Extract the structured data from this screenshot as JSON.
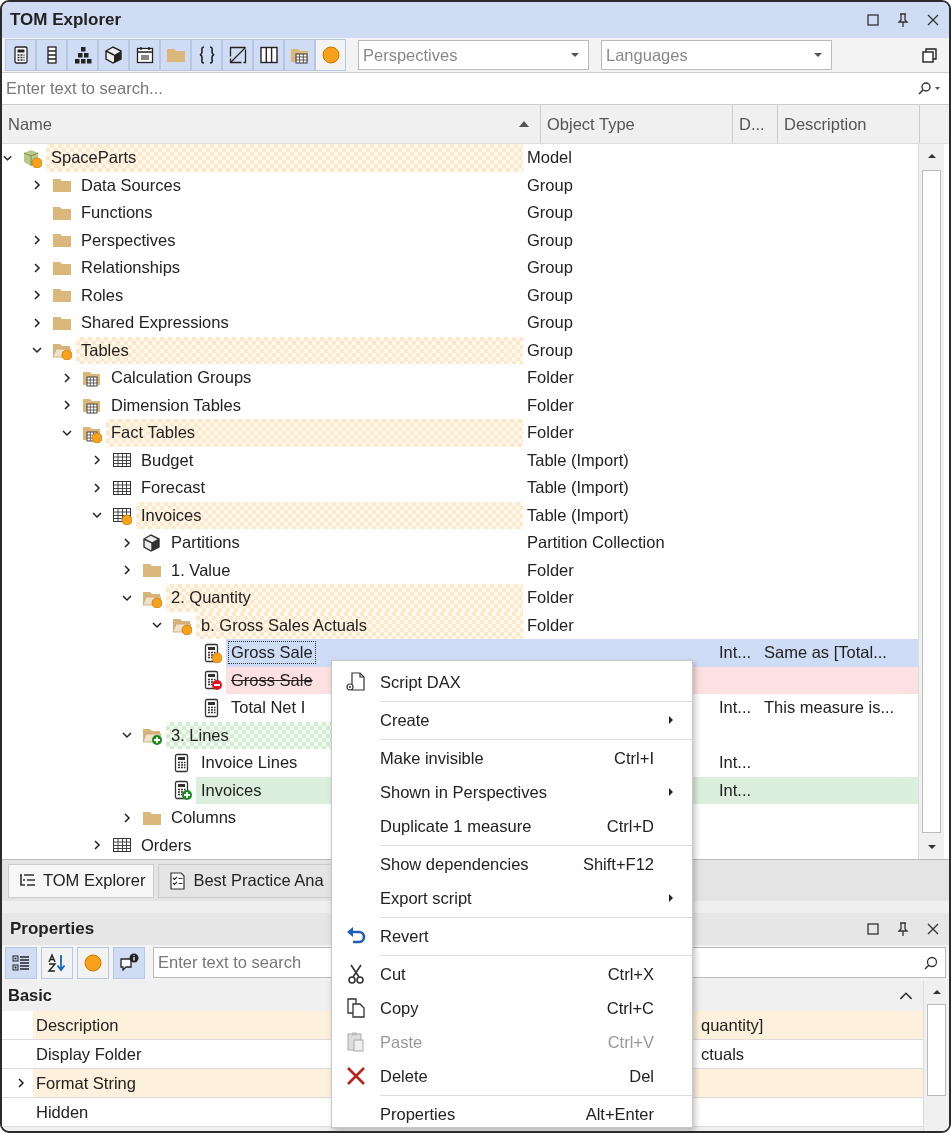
{
  "window": {
    "title": "TOM Explorer"
  },
  "toolbar": {
    "buttons": [
      {
        "kind": "calculator",
        "selected": true
      },
      {
        "kind": "column",
        "selected": true
      },
      {
        "kind": "hierarchy",
        "selected": true
      },
      {
        "kind": "cube",
        "selected": true
      },
      {
        "kind": "calendar",
        "selected": true
      },
      {
        "kind": "folder",
        "selected": true
      },
      {
        "kind": "braces",
        "selected": true
      },
      {
        "kind": "diagonal",
        "selected": true
      },
      {
        "kind": "columns",
        "selected": true
      },
      {
        "kind": "table-folder",
        "selected": true
      },
      {
        "kind": "dot",
        "selected": false
      }
    ],
    "perspectives": "Perspectives",
    "languages": "Languages"
  },
  "search": {
    "placeholder": "Enter text to search..."
  },
  "columns": [
    {
      "label": "Name",
      "sort_ascending": true
    },
    {
      "label": "Object Type"
    },
    {
      "label": "D..."
    },
    {
      "label": "Description"
    }
  ],
  "tree": [
    {
      "name": "SpaceParts",
      "type": "Model",
      "kind": "model",
      "modified": true,
      "expanded": true,
      "children": [
        {
          "name": "Data Sources",
          "type": "Group",
          "kind": "folder",
          "modified": false,
          "expanded": false
        },
        {
          "name": "Functions",
          "type": "Group",
          "kind": "folder",
          "modified": false
        },
        {
          "name": "Perspectives",
          "type": "Group",
          "kind": "folder",
          "modified": false,
          "expanded": false
        },
        {
          "name": "Relationships",
          "type": "Group",
          "kind": "folder",
          "modified": false,
          "expanded": false
        },
        {
          "name": "Roles",
          "type": "Group",
          "kind": "folder",
          "modified": false,
          "expanded": false
        },
        {
          "name": "Shared Expressions",
          "type": "Group",
          "kind": "folder",
          "modified": false,
          "expanded": false
        },
        {
          "name": "Tables",
          "type": "Group",
          "kind": "folder-open",
          "modified": true,
          "expanded": true,
          "children": [
            {
              "name": "Calculation Groups",
              "type": "Folder",
              "kind": "table-folder",
              "modified": false,
              "expanded": false
            },
            {
              "name": "Dimension Tables",
              "type": "Folder",
              "kind": "table-folder",
              "modified": false,
              "expanded": false
            },
            {
              "name": "Fact Tables",
              "type": "Folder",
              "kind": "table-folder",
              "modified": true,
              "expanded": true,
              "children": [
                {
                  "name": "Budget",
                  "type": "Table (Import)",
                  "kind": "table",
                  "modified": false,
                  "expanded": false
                },
                {
                  "name": "Forecast",
                  "type": "Table (Import)",
                  "kind": "table",
                  "modified": false,
                  "expanded": false
                },
                {
                  "name": "Invoices",
                  "type": "Table (Import)",
                  "kind": "table",
                  "modified": true,
                  "expanded": true,
                  "children": [
                    {
                      "name": "Partitions",
                      "type": "Partition Collection",
                      "kind": "partitions",
                      "modified": false,
                      "expanded": false
                    },
                    {
                      "name": "1. Value",
                      "type": "Folder",
                      "kind": "folder",
                      "modified": false,
                      "expanded": false
                    },
                    {
                      "name": "2. Quantity",
                      "type": "Folder",
                      "kind": "folder-open",
                      "modified": true,
                      "expanded": true,
                      "children": [
                        {
                          "name": "b. Gross Sales Actuals",
                          "type": "Folder",
                          "kind": "folder-open",
                          "modified": true,
                          "expanded": true,
                          "children": [
                            {
                              "name": "Gross Sale",
                              "kind": "measure",
                              "modified": true,
                              "added": false,
                              "deleted": false,
                              "selected": true,
                              "d": "Int...",
                              "description": "Same as [Total..."
                            },
                            {
                              "name": "Gross Sale",
                              "kind": "measure",
                              "modified": false,
                              "added": false,
                              "deleted": true,
                              "selected": false
                            },
                            {
                              "name": "Total Net I",
                              "kind": "measure",
                              "modified": false,
                              "added": false,
                              "deleted": false,
                              "selected": false,
                              "d": "Int...",
                              "description": "This measure is..."
                            }
                          ]
                        }
                      ]
                    },
                    {
                      "name": "3. Lines",
                      "kind": "folder-open",
                      "modified": false,
                      "added": true,
                      "expanded": true,
                      "children": [
                        {
                          "name": "Invoice Lines",
                          "kind": "measure",
                          "modified": false,
                          "added": false,
                          "deleted": false,
                          "selected": false,
                          "d": "Int..."
                        },
                        {
                          "name": "Invoices",
                          "kind": "measure",
                          "modified": false,
                          "added": true,
                          "deleted": false,
                          "selected": false,
                          "d": "Int..."
                        }
                      ]
                    },
                    {
                      "name": "Columns",
                      "kind": "folder",
                      "modified": false,
                      "expanded": false
                    }
                  ]
                },
                {
                  "name": "Orders",
                  "kind": "table",
                  "modified": false,
                  "expanded": false
                }
              ]
            }
          ]
        }
      ]
    }
  ],
  "bottom_tabs": [
    {
      "label": "TOM Explorer",
      "kind": "tree",
      "selected": true
    },
    {
      "label": "Best Practice Ana",
      "kind": "checklist",
      "selected": false
    }
  ],
  "properties": {
    "title": "Properties",
    "toolbar": [
      {
        "kind": "categorized",
        "selected": true
      },
      {
        "kind": "sort-az",
        "selected": false
      },
      {
        "kind": "dot",
        "selected": false
      },
      {
        "kind": "comment",
        "selected": true
      }
    ],
    "search": {
      "placeholder": "Enter text to search"
    },
    "category": "Basic",
    "rows": [
      {
        "name": "Description",
        "value": "quantity]",
        "modified": true
      },
      {
        "name": "Display Folder",
        "value": "ctuals",
        "modified": false
      },
      {
        "name": "Format String",
        "modified": true,
        "expanded": false
      },
      {
        "name": "Hidden",
        "modified": false
      }
    ]
  },
  "context_menu": [
    {
      "kind": "script",
      "label": "Script DAX"
    },
    {
      "kind": "separator"
    },
    {
      "kind": "item",
      "label": "Create",
      "submenu": true
    },
    {
      "kind": "separator"
    },
    {
      "kind": "item",
      "label": "Make invisible",
      "shortcut": "Ctrl+I"
    },
    {
      "kind": "item",
      "label": "Shown in Perspectives",
      "submenu": true
    },
    {
      "kind": "item",
      "label": "Duplicate 1 measure",
      "shortcut": "Ctrl+D"
    },
    {
      "kind": "separator"
    },
    {
      "kind": "item",
      "label": "Show dependencies",
      "shortcut": "Shift+F12"
    },
    {
      "kind": "item",
      "label": "Export script",
      "submenu": true
    },
    {
      "kind": "separator"
    },
    {
      "kind": "revert",
      "label": "Revert"
    },
    {
      "kind": "separator"
    },
    {
      "kind": "cut",
      "label": "Cut",
      "shortcut": "Ctrl+X"
    },
    {
      "kind": "copy",
      "label": "Copy",
      "shortcut": "Ctrl+C"
    },
    {
      "kind": "paste",
      "label": "Paste",
      "shortcut": "Ctrl+V",
      "disabled": true
    },
    {
      "kind": "delete",
      "label": "Delete",
      "shortcut": "Del"
    },
    {
      "kind": "separator"
    },
    {
      "kind": "item",
      "label": "Properties",
      "shortcut": "Alt+Enter"
    }
  ]
}
